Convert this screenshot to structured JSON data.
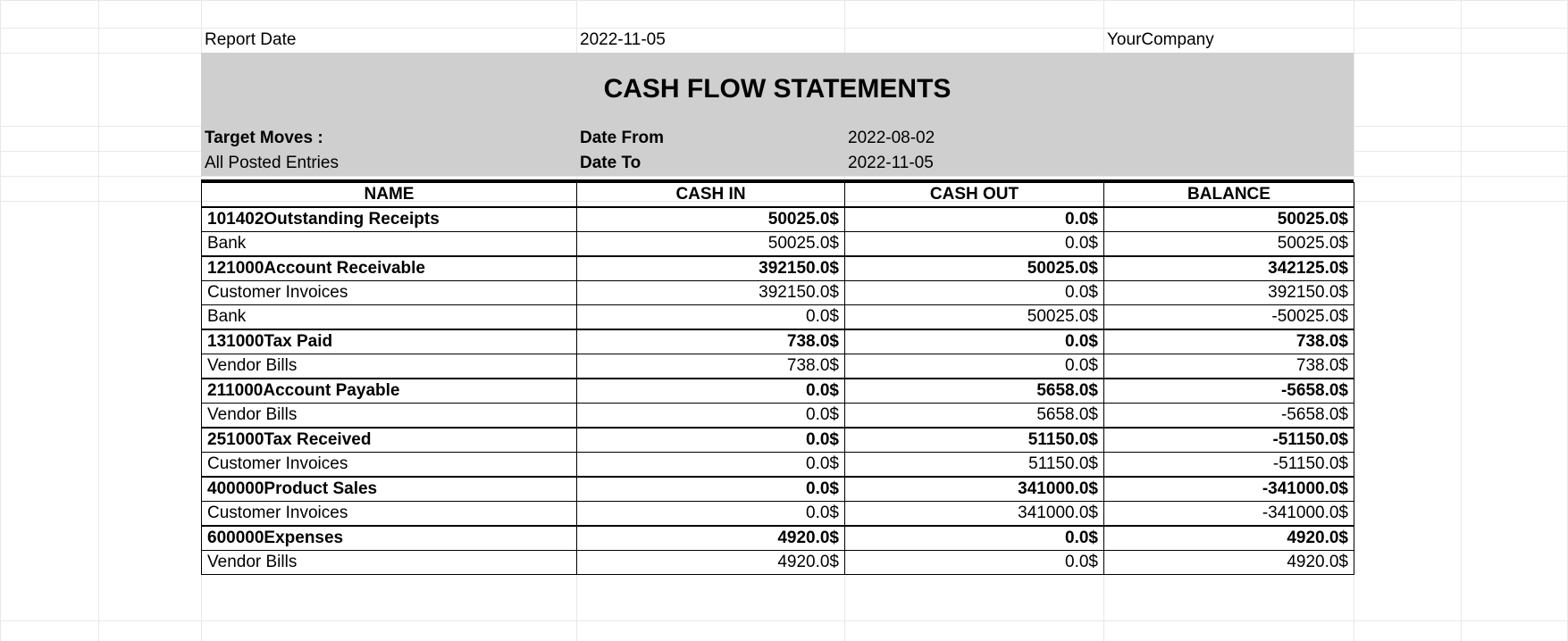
{
  "header": {
    "report_date_label": "Report Date",
    "report_date_value": "2022-11-05",
    "company": "YourCompany",
    "title": "CASH FLOW STATEMENTS",
    "target_moves_label": "Target Moves :",
    "target_moves_value": "All Posted Entries",
    "date_from_label": "Date From",
    "date_from_value": "2022-08-02",
    "date_to_label": "Date To",
    "date_to_value": "2022-11-05"
  },
  "columns": {
    "name": "NAME",
    "cash_in": "CASH IN",
    "cash_out": "CASH OUT",
    "balance": "BALANCE"
  },
  "rows": [
    {
      "type": "group",
      "name": "101402Outstanding Receipts",
      "cash_in": "50025.0$",
      "cash_out": "0.0$",
      "balance": "50025.0$"
    },
    {
      "type": "detail",
      "name": "Bank",
      "cash_in": "50025.0$",
      "cash_out": "0.0$",
      "balance": "50025.0$"
    },
    {
      "type": "group",
      "name": "121000Account Receivable",
      "cash_in": "392150.0$",
      "cash_out": "50025.0$",
      "balance": "342125.0$"
    },
    {
      "type": "detail",
      "name": "Customer Invoices",
      "cash_in": "392150.0$",
      "cash_out": "0.0$",
      "balance": "392150.0$"
    },
    {
      "type": "detail",
      "name": "Bank",
      "cash_in": "0.0$",
      "cash_out": "50025.0$",
      "balance": "-50025.0$"
    },
    {
      "type": "group",
      "name": "131000Tax Paid",
      "cash_in": "738.0$",
      "cash_out": "0.0$",
      "balance": "738.0$"
    },
    {
      "type": "detail",
      "name": "Vendor Bills",
      "cash_in": "738.0$",
      "cash_out": "0.0$",
      "balance": "738.0$"
    },
    {
      "type": "group",
      "name": "211000Account Payable",
      "cash_in": "0.0$",
      "cash_out": "5658.0$",
      "balance": "-5658.0$"
    },
    {
      "type": "detail",
      "name": "Vendor Bills",
      "cash_in": "0.0$",
      "cash_out": "5658.0$",
      "balance": "-5658.0$"
    },
    {
      "type": "group",
      "name": "251000Tax Received",
      "cash_in": "0.0$",
      "cash_out": "51150.0$",
      "balance": "-51150.0$"
    },
    {
      "type": "detail",
      "name": "Customer Invoices",
      "cash_in": "0.0$",
      "cash_out": "51150.0$",
      "balance": "-51150.0$"
    },
    {
      "type": "group",
      "name": "400000Product Sales",
      "cash_in": "0.0$",
      "cash_out": "341000.0$",
      "balance": "-341000.0$"
    },
    {
      "type": "detail",
      "name": "Customer Invoices",
      "cash_in": "0.0$",
      "cash_out": "341000.0$",
      "balance": "-341000.0$"
    },
    {
      "type": "group",
      "name": "600000Expenses",
      "cash_in": "4920.0$",
      "cash_out": "0.0$",
      "balance": "4920.0$"
    },
    {
      "type": "detail",
      "name": "Vendor Bills",
      "cash_in": "4920.0$",
      "cash_out": "0.0$",
      "balance": "4920.0$"
    }
  ]
}
